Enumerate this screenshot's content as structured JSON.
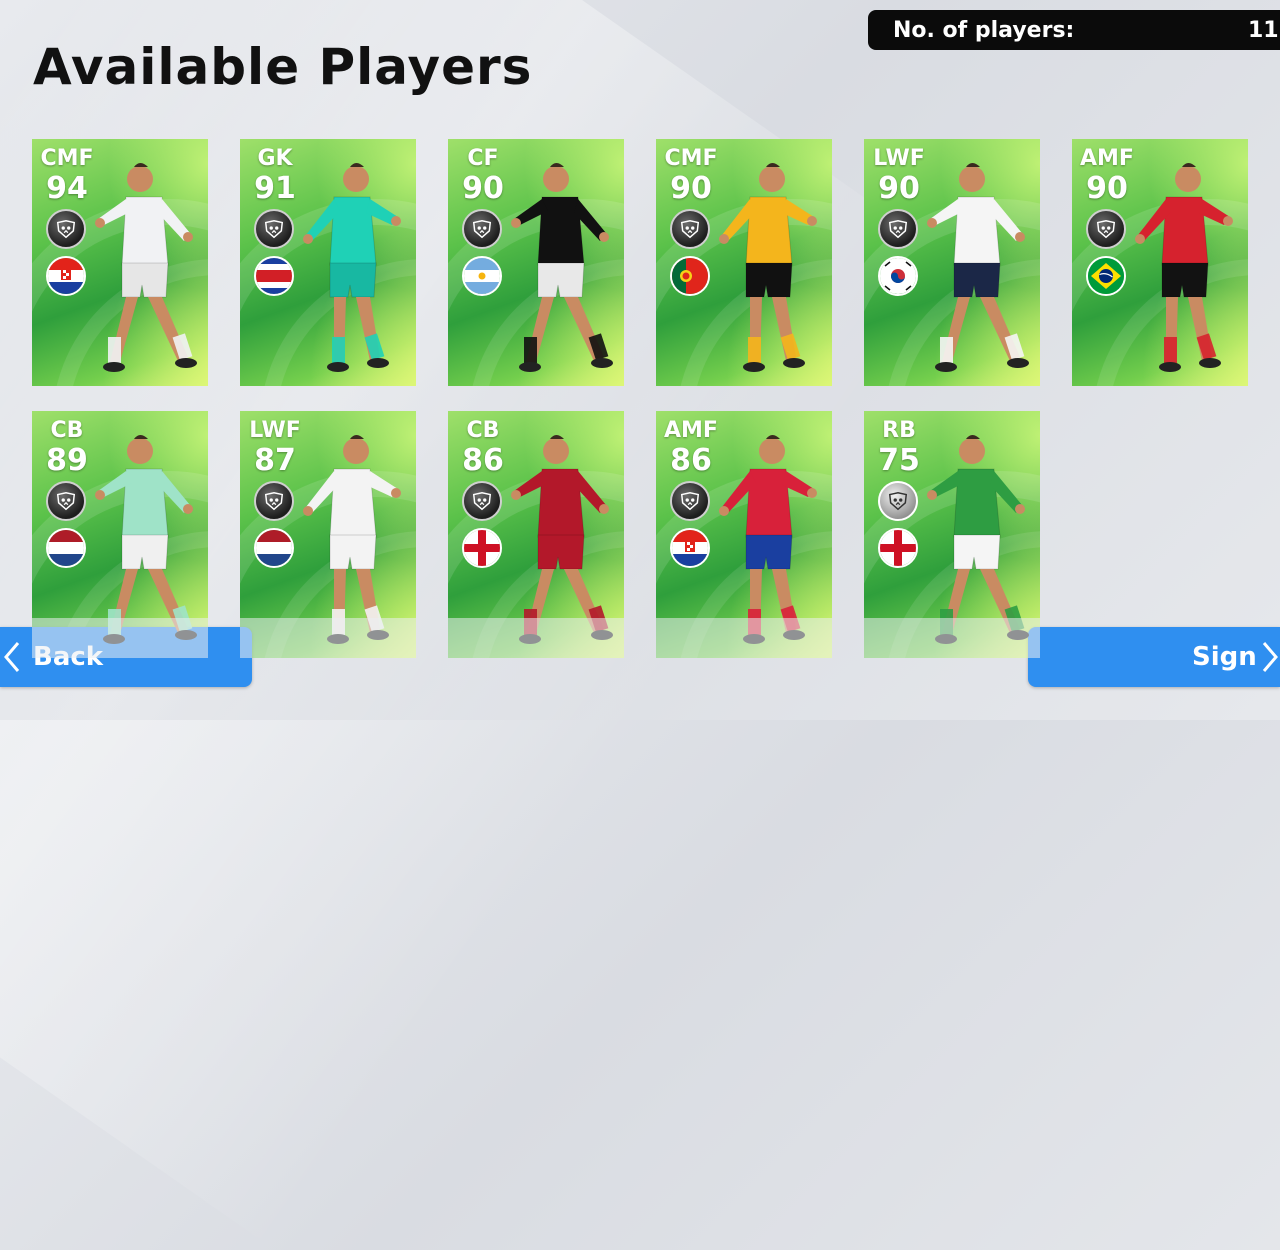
{
  "header": {
    "title": "Available Players",
    "count_label": "No. of players:",
    "count_value": "11"
  },
  "players": [
    {
      "position": "CMF",
      "rating": "94",
      "flag": "croatia-flag",
      "skill": "black-ball",
      "kit": "#f1f2f4",
      "shorts": "#e6e6e6"
    },
    {
      "position": "GK",
      "rating": "91",
      "flag": "costa-rica-flag",
      "skill": "black-ball",
      "kit": "#1fd1b6",
      "shorts": "#18b8a2"
    },
    {
      "position": "CF",
      "rating": "90",
      "flag": "argentina-flag",
      "skill": "black-ball",
      "kit": "#111111",
      "shorts": "#e8e8e8"
    },
    {
      "position": "CMF",
      "rating": "90",
      "flag": "portugal-flag",
      "skill": "black-ball",
      "kit": "#f4b51c",
      "shorts": "#111111"
    },
    {
      "position": "LWF",
      "rating": "90",
      "flag": "south-korea-flag",
      "skill": "black-ball",
      "kit": "#f5f5f5",
      "shorts": "#1b2747"
    },
    {
      "position": "AMF",
      "rating": "90",
      "flag": "brazil-flag",
      "skill": "black-ball",
      "kit": "#d6222e",
      "shorts": "#121212"
    },
    {
      "position": "CB",
      "rating": "89",
      "flag": "netherlands-flag",
      "skill": "black-ball",
      "kit": "#9fe3c8",
      "shorts": "#f0f0f0"
    },
    {
      "position": "LWF",
      "rating": "87",
      "flag": "netherlands-flag",
      "skill": "black-ball",
      "kit": "#f3f3f3",
      "shorts": "#f3f3f3"
    },
    {
      "position": "CB",
      "rating": "86",
      "flag": "england-flag",
      "skill": "black-ball",
      "kit": "#b3182a",
      "shorts": "#b3182a"
    },
    {
      "position": "AMF",
      "rating": "86",
      "flag": "croatia-flag",
      "skill": "black-ball",
      "kit": "#d8213a",
      "shorts": "#1a3fa0"
    },
    {
      "position": "RB",
      "rating": "75",
      "flag": "england-flag",
      "skill": "silver-ball",
      "kit": "#2e9d42",
      "shorts": "#f5f5f5"
    }
  ],
  "footer": {
    "back_label": "Back",
    "sign_label": "Sign"
  },
  "colors": {
    "accent": "#2f8ff0",
    "header_bg": "#0b0b0b"
  }
}
